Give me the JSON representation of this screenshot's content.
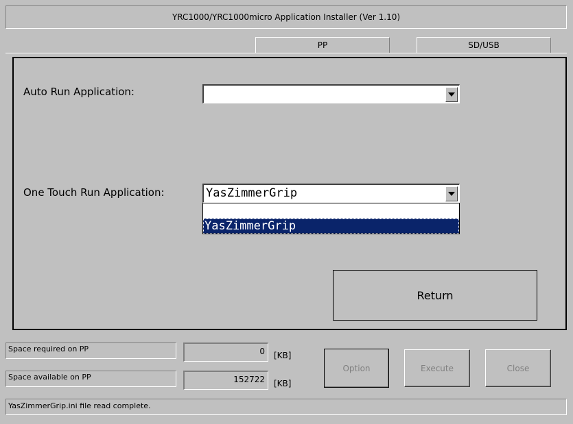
{
  "window": {
    "title": "YRC1000/YRC1000micro Application Installer  (Ver 1.10)"
  },
  "tabs": [
    {
      "label": "PP"
    },
    {
      "label": "SD/USB"
    }
  ],
  "form": {
    "auto_run_label": "Auto Run Application:",
    "auto_run_value": "",
    "one_touch_label": "One Touch Run Application:",
    "one_touch_value": "YasZimmerGrip",
    "one_touch_options": [
      "",
      "YasZimmerGrip"
    ],
    "one_touch_selected_option": "YasZimmerGrip"
  },
  "buttons": {
    "return_label": "Return",
    "option_label": "Option",
    "execute_label": "Execute",
    "close_label": "Close"
  },
  "space": {
    "required_label": "Space required on PP",
    "required_value": "0",
    "available_label": "Space available on PP",
    "available_value": "152722",
    "unit": "[KB]"
  },
  "status": {
    "text": "YasZimmerGrip.ini file read complete."
  },
  "colors": {
    "background": "#c0c0c0",
    "selection": "#0a246a"
  }
}
